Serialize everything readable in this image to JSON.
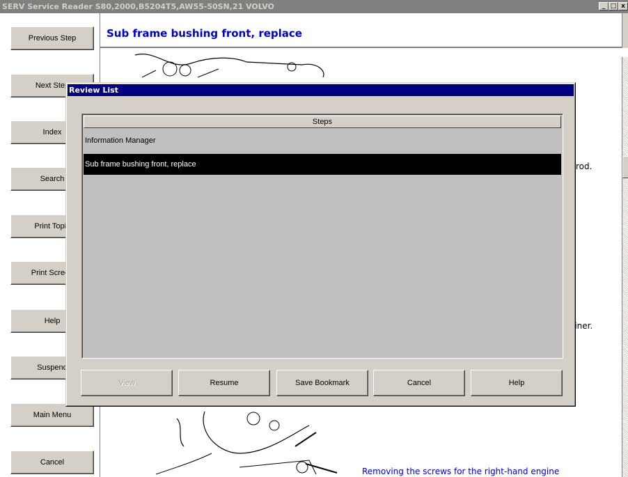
{
  "window": {
    "title": "SERV Service Reader S80,2000,B5204T5,AW55-50SN,21 VOLVO",
    "minimize_glyph": "_",
    "maximize_glyph": "□",
    "close_glyph": "x"
  },
  "nav": {
    "previous_step": "Previous Step",
    "next_step": "Next Step",
    "index": "Index",
    "search": "Search",
    "print_topic": "Print Topic",
    "print_screen": "Print Screen",
    "help": "Help",
    "suspend": "Suspend",
    "main_menu": "Main Menu",
    "cancel": "Cancel"
  },
  "document": {
    "title": "Sub frame bushing front, replace",
    "text_fragment_1": "rod.",
    "text_fragment_2": "liner.",
    "caption": "Removing the screws for the right-hand engine"
  },
  "dialog": {
    "title": "Review List",
    "list_header": "Steps",
    "items": [
      {
        "label": "Information Manager",
        "selected": false
      },
      {
        "label": "Sub frame bushing front, replace",
        "selected": true
      }
    ],
    "buttons": {
      "view": "View",
      "resume": "Resume",
      "save_bookmark": "Save Bookmark",
      "cancel": "Cancel",
      "help": "Help"
    }
  },
  "colors": {
    "dialog_titlebar": "#000080",
    "doc_title": "#0000cc",
    "selection": "#000000",
    "face": "#d4d0c8"
  }
}
